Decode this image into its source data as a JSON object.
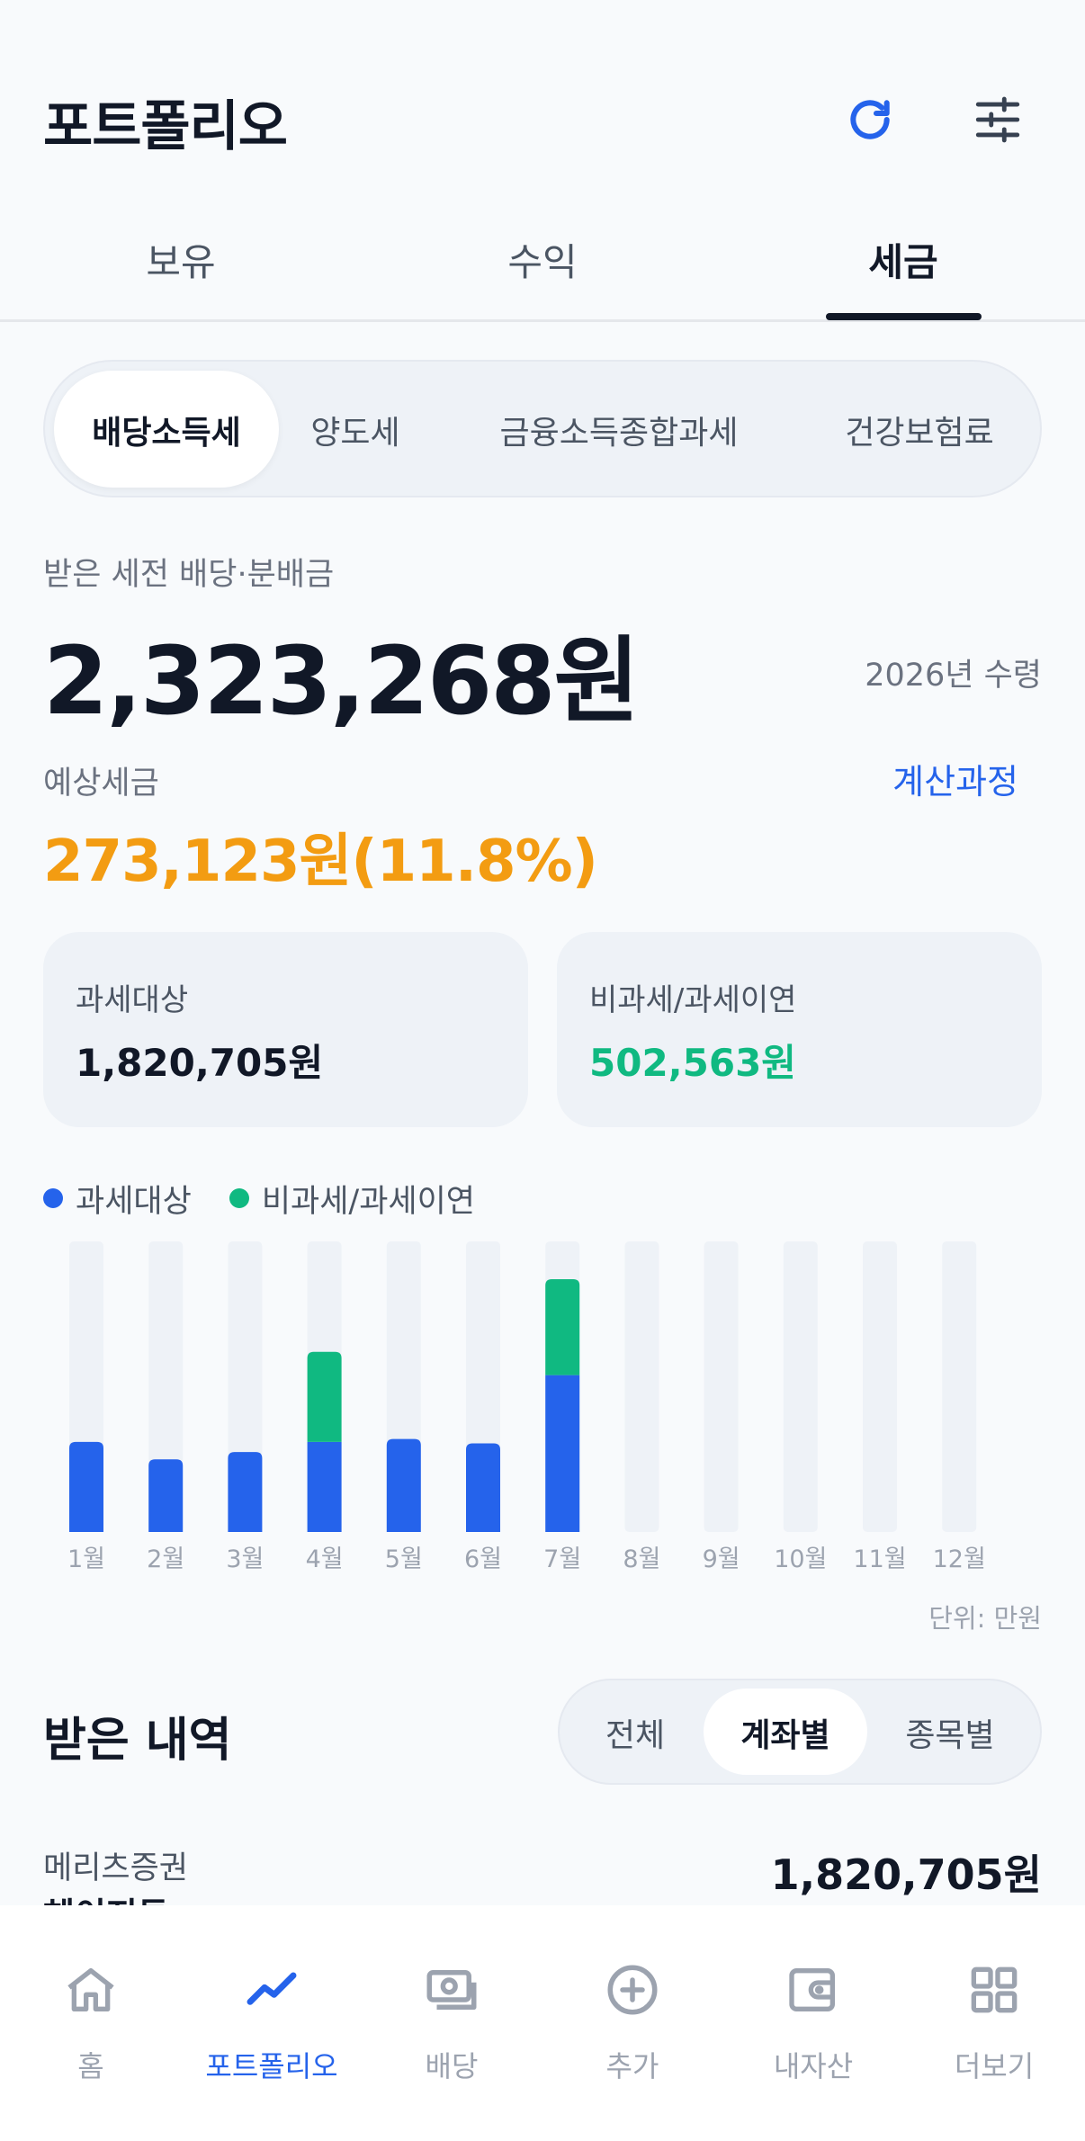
{
  "header": {
    "title": "포트폴리오",
    "refresh_icon": "refresh-icon",
    "filter_icon": "sliders-icon"
  },
  "tabs": [
    {
      "label": "보유",
      "active": false
    },
    {
      "label": "수익",
      "active": false
    },
    {
      "label": "세금",
      "active": true
    }
  ],
  "tax_types": [
    {
      "label": "배당소득세",
      "active": true
    },
    {
      "label": "양도세",
      "active": false
    },
    {
      "label": "금융소득종합과세",
      "active": false
    },
    {
      "label": "건강보험료",
      "active": false
    }
  ],
  "summary": {
    "received_label": "받은 세전 배당·분배금",
    "received_amount": "2,323,268원",
    "received_year": "2026년 수령",
    "estimated_tax_label": "예상세금",
    "calc_link": "계산과정",
    "estimated_tax": "273,123원(11.8%)"
  },
  "cards": {
    "taxable_label": "과세대상",
    "taxable_amount": "1,820,705원",
    "nontaxable_label": "비과세/과세이연",
    "nontaxable_amount": "502,563원"
  },
  "colors": {
    "taxable": "#2563eb",
    "nontaxable": "#10b981",
    "track": "#eef2f7",
    "accent_orange": "#f39c12"
  },
  "chart_data": {
    "type": "bar",
    "stacked": true,
    "categories": [
      "1월",
      "2월",
      "3월",
      "4월",
      "5월",
      "6월",
      "7월",
      "8월",
      "9월",
      "10월",
      "11월",
      "12월"
    ],
    "series": [
      {
        "name": "과세대상",
        "values": [
          31,
          25,
          27.5,
          31,
          32,
          30.5,
          54,
          0,
          0,
          0,
          0,
          0
        ]
      },
      {
        "name": "비과세/과세이연",
        "values": [
          0,
          0,
          0,
          31,
          0,
          0,
          33,
          0,
          0,
          0,
          0,
          0
        ]
      }
    ],
    "ylim": [
      0,
      100
    ],
    "unit_label": "단위: 만원",
    "legend_position": "top-left"
  },
  "history": {
    "title": "받은 내역",
    "filters": [
      {
        "label": "전체",
        "active": false
      },
      {
        "label": "계좌별",
        "active": true
      },
      {
        "label": "종목별",
        "active": false
      }
    ],
    "rows": [
      {
        "label": "메리츠증권",
        "sub": "헤이지투",
        "amount": "1,820,705원"
      }
    ]
  },
  "bottom_nav": [
    {
      "label": "홈",
      "icon": "home-icon",
      "active": false
    },
    {
      "label": "포트폴리오",
      "icon": "trend-icon",
      "active": true
    },
    {
      "label": "배당",
      "icon": "cash-icon",
      "active": false
    },
    {
      "label": "추가",
      "icon": "plus-circle-icon",
      "active": false
    },
    {
      "label": "내자산",
      "icon": "wallet-icon",
      "active": false
    },
    {
      "label": "더보기",
      "icon": "grid-icon",
      "active": false
    }
  ]
}
